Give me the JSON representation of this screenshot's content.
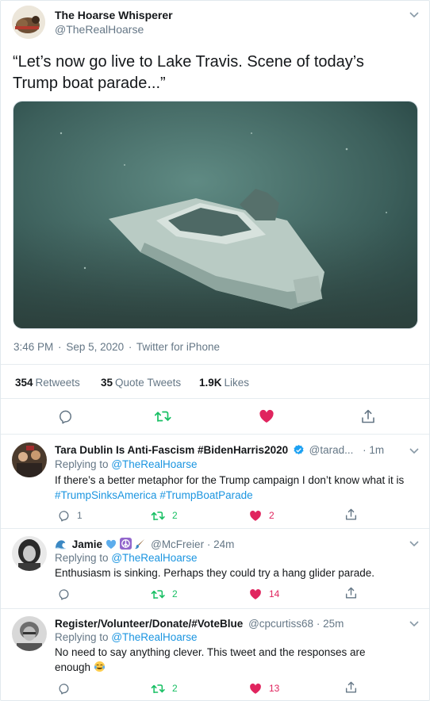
{
  "tweet": {
    "author": {
      "name": "The Hoarse Whisperer",
      "handle": "@TheRealHoarse",
      "avatar_icon": "horse-avatar"
    },
    "text": "“Let’s now go live to Lake Travis. Scene of today’s Trump boat parade...”",
    "media": {
      "icon": "underwater-sunken-boat-photo"
    },
    "time": "3:46 PM",
    "date": "Sep 5, 2020",
    "source": "Twitter for iPhone",
    "separator": "·",
    "stats": {
      "retweets_count": "354",
      "retweets_label": "Retweets",
      "quotes_count": "35",
      "quotes_label": "Quote Tweets",
      "likes_count": "1.9K",
      "likes_label": "Likes"
    },
    "actions": [
      "reply-icon",
      "retweet-icon",
      "like-icon",
      "share-icon"
    ]
  },
  "replies": [
    {
      "name": "Tara Dublin Is Anti-Fascism #BidenHarris2020",
      "verified": true,
      "handle": "@tarad...",
      "time_sep": "·",
      "time": "1m",
      "replying_prefix": "Replying to",
      "replying_to": "@TheRealHoarse",
      "text_plain": "If there’s a better metaphor for the Trump campaign I don’t know what it is",
      "hashtags": [
        "#TrumpSinksAmerica",
        "#TrumpBoatParade"
      ],
      "reply_count": "1",
      "retweet_count": "2",
      "like_count": "2"
    },
    {
      "name": "Jamie",
      "name_emoji_icons": [
        "wave-icon",
        "blue-heart-icon",
        "peace-sign-icon",
        "paintbrush-icon"
      ],
      "handle": "@McFreier",
      "time_sep": "·",
      "time": "24m",
      "replying_prefix": "Replying to",
      "replying_to": "@TheRealHoarse",
      "text_plain": "Enthusiasm is sinking. Perhaps they could try a hang glider parade.",
      "reply_count": "",
      "retweet_count": "2",
      "like_count": "14"
    },
    {
      "name": "Register/Volunteer/Donate/#VoteBlue",
      "handle": "@cpcurtiss68",
      "time_sep": "·",
      "time": "25m",
      "replying_prefix": "Replying to",
      "replying_to": "@TheRealHoarse",
      "text_line1": "No need to say anything clever. This tweet and the responses are",
      "text_line2": "enough",
      "text_emoji_icon": "tears-of-joy-icon",
      "reply_count": "",
      "retweet_count": "2",
      "like_count": "13"
    }
  ],
  "colors": {
    "link": "#1b95e0",
    "muted": "#657786",
    "retweet": "#17bf63",
    "like": "#e0245e"
  }
}
